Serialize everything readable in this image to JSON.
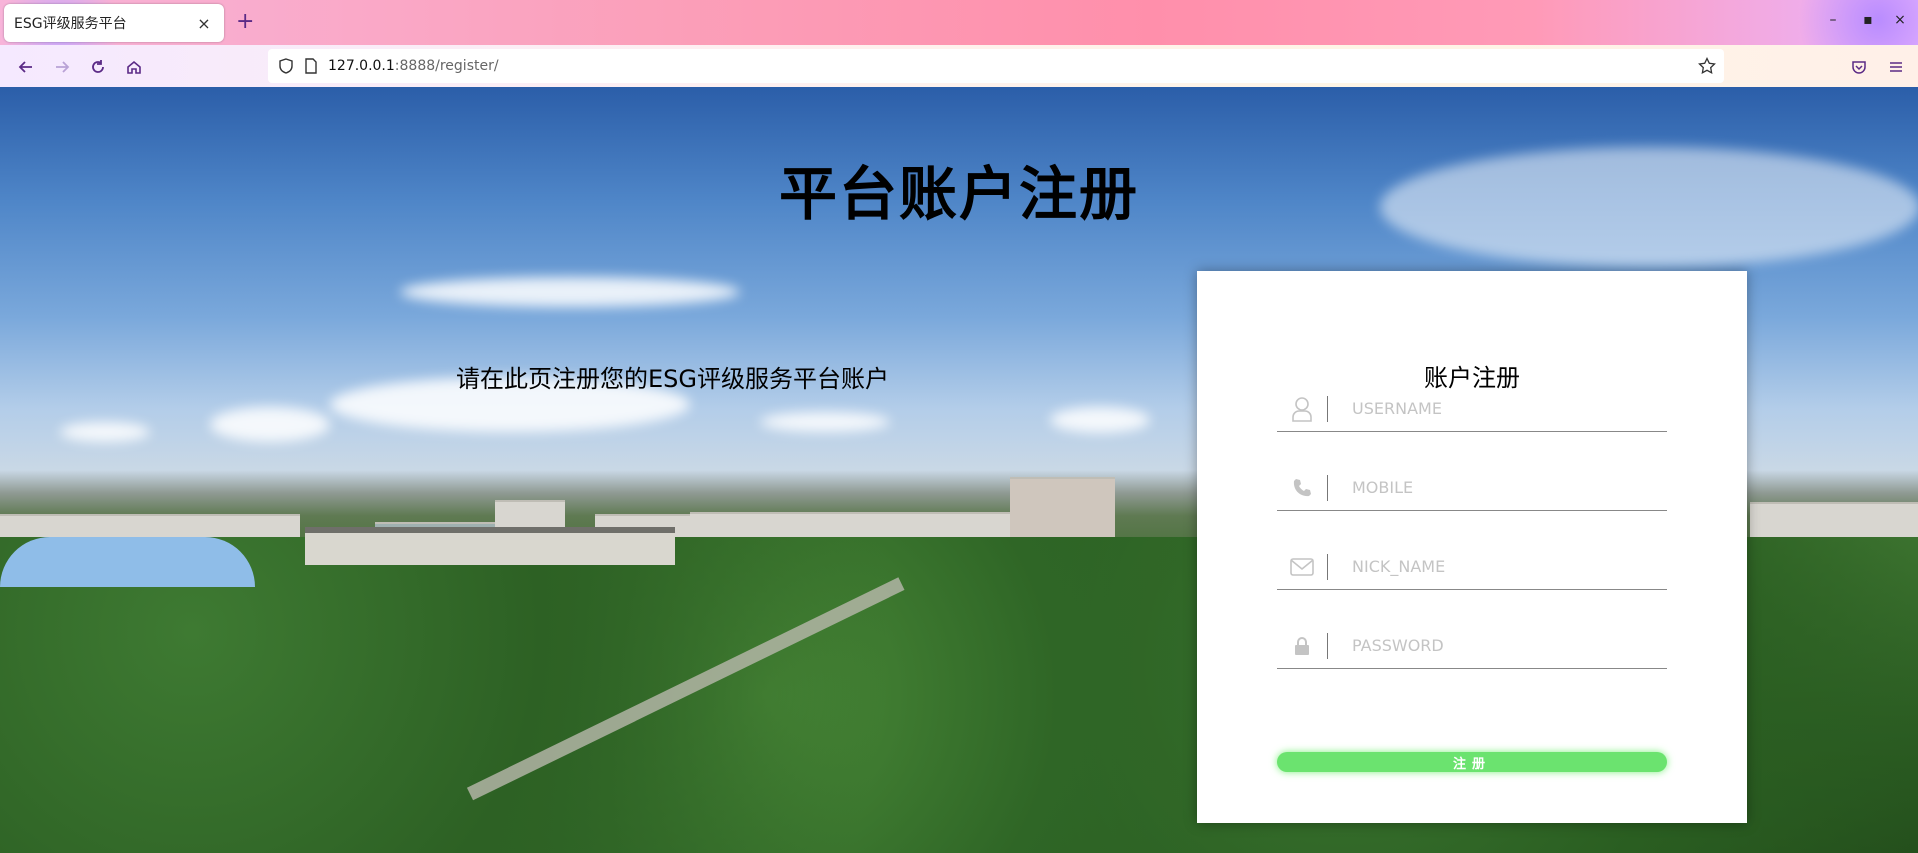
{
  "browser": {
    "tab_title": "ESG评级服务平台",
    "tab_close": "×",
    "new_tab": "+",
    "url_host": "127.0.0.1",
    "url_path": ":8888/register/",
    "window_controls": [
      "–",
      "▪",
      "×"
    ]
  },
  "page": {
    "title": "平台账户注册",
    "subtitle": "请在此页注册您的ESG评级服务平台账户"
  },
  "form": {
    "title": "账户注册",
    "fields": [
      {
        "icon": "user-icon",
        "placeholder": "USERNAME"
      },
      {
        "icon": "phone-icon",
        "placeholder": "MOBILE"
      },
      {
        "icon": "envelope-icon",
        "placeholder": "NICK_NAME"
      },
      {
        "icon": "lock-icon",
        "placeholder": "PASSWORD"
      }
    ],
    "submit_label": "注册"
  },
  "colors": {
    "submit_button": "#6be36f",
    "icon_gray": "#c4c4c4",
    "tab_accent": "#5b2a86"
  }
}
